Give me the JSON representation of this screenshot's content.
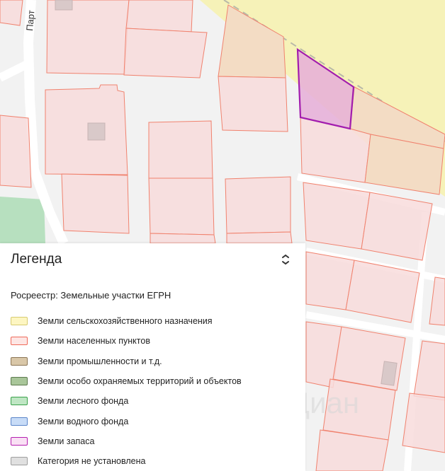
{
  "map": {
    "street_label": "Парт",
    "watermark_text": "Циан",
    "colors": {
      "agricultural_zone": "#f6f2b8",
      "forest_zone": "#b7e0bf",
      "settlement_parcel_fill": "#f8dcdc",
      "settlement_parcel_stroke": "#f0826e",
      "selected_parcel_stroke": "#a21cae"
    }
  },
  "legend": {
    "title": "Легенда",
    "toggle_icon": "chevron-collapse-icon",
    "subtitle": "Росреестр: Земельные участки ЕГРН",
    "items": [
      {
        "label": "Земли сельскохозяйственного назначения",
        "fill": "#fdf6c2",
        "border": "#d7cc72"
      },
      {
        "label": "Земли населенных пунктов",
        "fill": "#fde6e4",
        "border": "#ef6a5a"
      },
      {
        "label": "Земли промышленности и т.д.",
        "fill": "#d9c7a8",
        "border": "#8c7656"
      },
      {
        "label": "Земли особо охраняемых территорий и объектов",
        "fill": "#a9c69a",
        "border": "#5c7a4e"
      },
      {
        "label": "Земли лесного фонда",
        "fill": "#bfe6c4",
        "border": "#3aa24b"
      },
      {
        "label": "Земли водного фонда",
        "fill": "#c8dcf7",
        "border": "#5b86c9"
      },
      {
        "label": "Земли запаса",
        "fill": "#f9e0f4",
        "border": "#b51fb0"
      },
      {
        "label": "Категория не установлена",
        "fill": "#e0e0e0",
        "border": "#9e9e9e"
      }
    ]
  }
}
